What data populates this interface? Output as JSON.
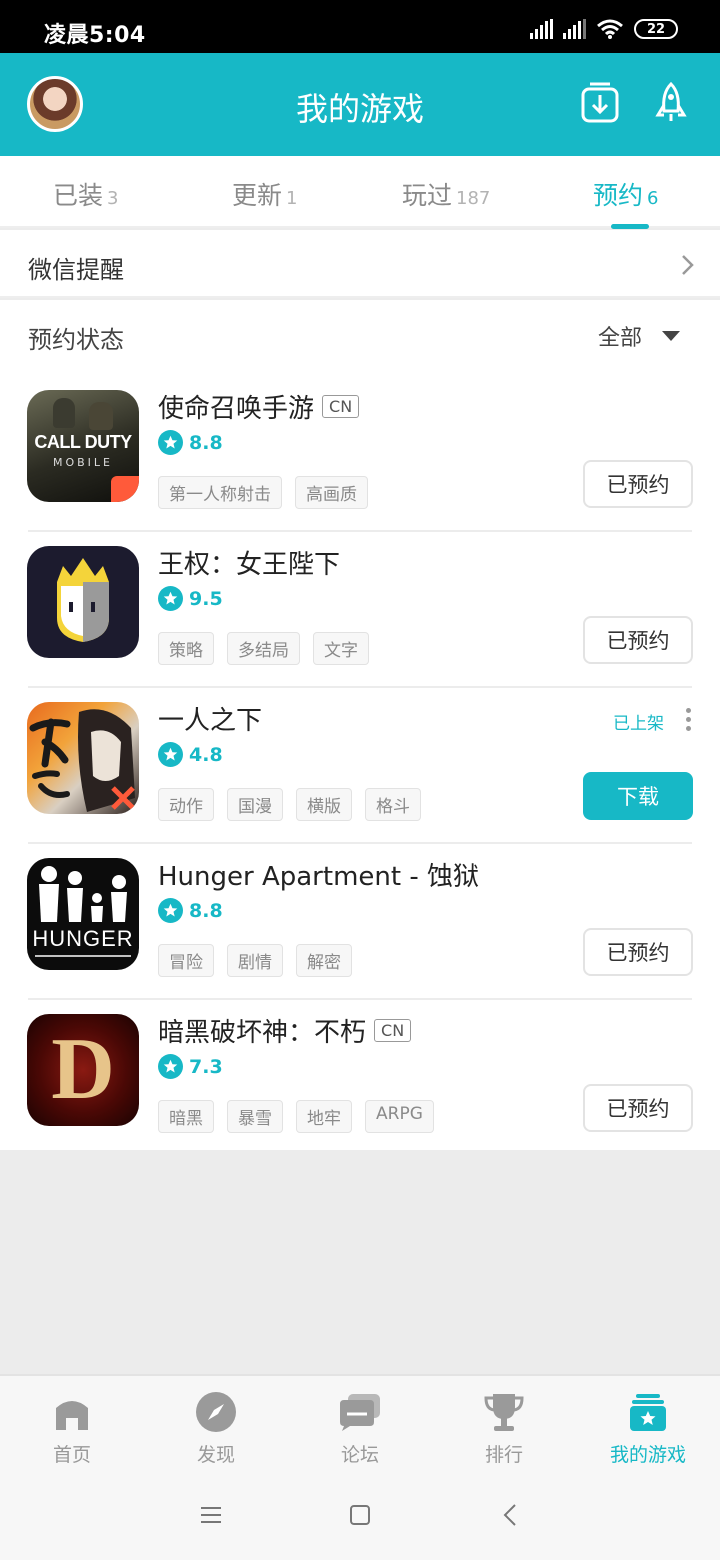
{
  "status_bar": {
    "time": "凌晨5:04",
    "battery": "22"
  },
  "header": {
    "title": "我的游戏",
    "download_icon": "download-box-icon",
    "rocket_icon": "rocket-icon"
  },
  "tabs": [
    {
      "label": "已装",
      "count": "3"
    },
    {
      "label": "更新",
      "count": "1"
    },
    {
      "label": "玩过",
      "count": "187"
    },
    {
      "label": "预约",
      "count": "6"
    }
  ],
  "active_tab": "预约",
  "wechat_reminder": {
    "label": "微信提醒"
  },
  "reservation": {
    "header": "预约状态",
    "filter": "全部"
  },
  "games": [
    {
      "name": "使命召唤手游",
      "badge": "CN",
      "rating": "8.8",
      "tags": [
        "第一人称射击",
        "高画质"
      ],
      "action": "已预约"
    },
    {
      "name": "王权：女王陛下",
      "rating": "9.5",
      "tags": [
        "策略",
        "多结局",
        "文字"
      ],
      "action": "已预约"
    },
    {
      "name": "一人之下",
      "rating": "4.8",
      "tags": [
        "动作",
        "国漫",
        "横版",
        "格斗"
      ],
      "status": "已上架",
      "action": "下载"
    },
    {
      "name": "Hunger Apartment - 蚀狱",
      "rating": "8.8",
      "tags": [
        "冒险",
        "剧情",
        "解密"
      ],
      "action": "已预约"
    },
    {
      "name": "暗黑破坏神：不朽",
      "badge": "CN",
      "rating": "7.3",
      "tags": [
        "暗黑",
        "暴雪",
        "地牢",
        "ARPG"
      ],
      "action": "已预约"
    }
  ],
  "game_icon_texts": {
    "cod_line1": "CALL DUTY",
    "cod_line2": "MOBILE",
    "hunger": "HUNGER",
    "diablo": "D"
  },
  "bottom_nav": [
    {
      "label": "首页",
      "icon": "home-icon"
    },
    {
      "label": "发现",
      "icon": "compass-icon"
    },
    {
      "label": "论坛",
      "icon": "forum-icon"
    },
    {
      "label": "排行",
      "icon": "trophy-icon"
    },
    {
      "label": "我的游戏",
      "icon": "my-games-icon"
    }
  ],
  "colors": {
    "accent": "#17b8c6",
    "text": "#222222",
    "muted": "#999999"
  }
}
